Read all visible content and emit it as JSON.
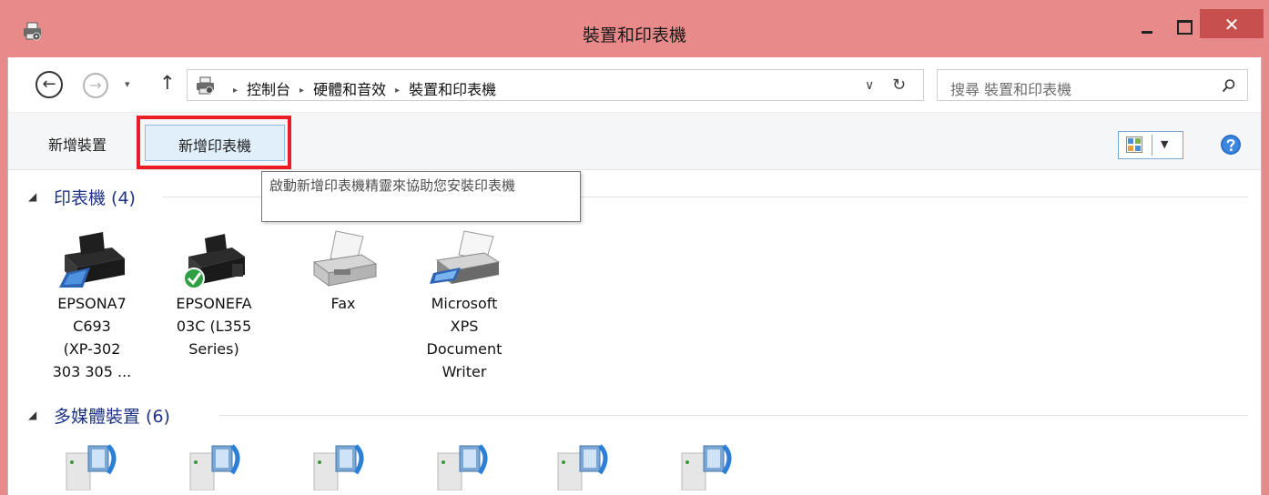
{
  "window": {
    "title": "裝置和印表機",
    "close_glyph": "✕"
  },
  "nav": {
    "back_glyph": "←",
    "forward_glyph": "→",
    "dropdown_glyph": "▾",
    "up_glyph": "↑"
  },
  "address": {
    "breadcrumbs": [
      "控制台",
      "硬體和音效",
      "裝置和印表機"
    ],
    "separator_glyph": "▸",
    "dropdown_glyph": "∨",
    "refresh_glyph": "↻"
  },
  "search": {
    "placeholder": "搜尋 裝置和印表機"
  },
  "toolbar": {
    "add_device": "新增裝置",
    "add_printer": "新增印表機",
    "view_dropdown_glyph": "▼"
  },
  "tooltip": {
    "text": "啟動新增印表機精靈來協助您安裝印表機"
  },
  "groups": {
    "printers": {
      "collapse_glyph": "◢",
      "title": "印表機 (4)"
    },
    "multimedia": {
      "collapse_glyph": "◢",
      "title": "多媒體裝置 (6)"
    }
  },
  "printers": [
    {
      "lines": [
        "EPSONA7",
        "C693",
        "(XP-302",
        "303 305 ..."
      ],
      "default": false
    },
    {
      "lines": [
        "EPSONEFA",
        "03C (L355",
        "Series)"
      ],
      "default": true
    },
    {
      "lines": [
        "Fax"
      ],
      "default": false
    },
    {
      "lines": [
        "Microsoft",
        "XPS",
        "Document",
        "Writer"
      ],
      "default": false
    }
  ],
  "multimedia_count": 6,
  "colors": {
    "titlebar": "#e78a89",
    "close_button": "#c7504f",
    "highlight_border": "#ed1c24",
    "group_title": "#1e3287"
  }
}
